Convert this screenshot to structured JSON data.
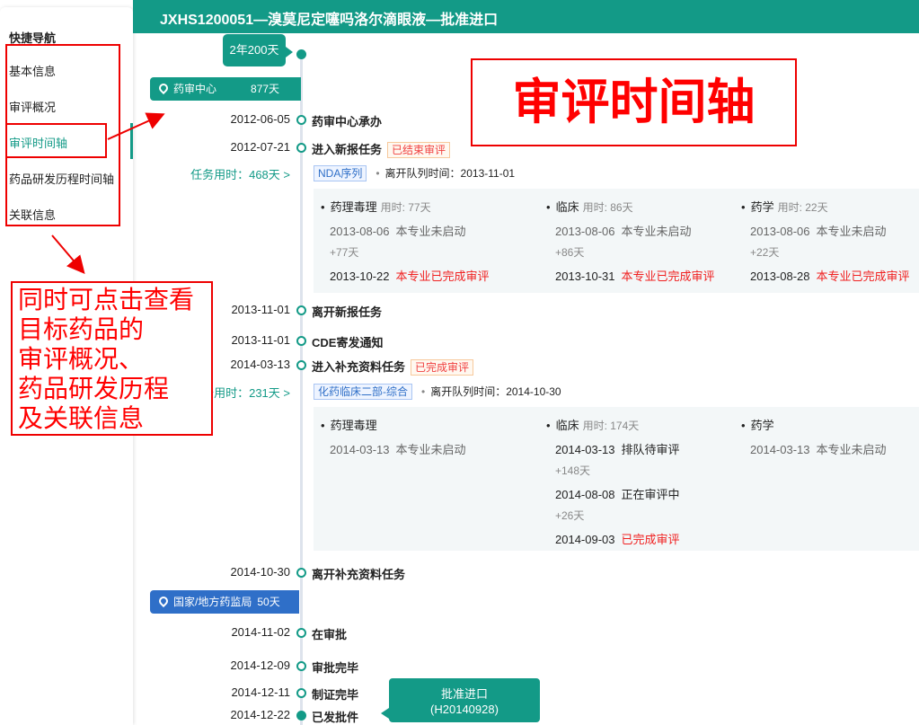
{
  "header": {
    "title": "JXHS1200051—溴莫尼定噻吗洛尔滴眼液—批准进口"
  },
  "sidebar": {
    "title": "快捷导航",
    "items": [
      {
        "label": "基本信息"
      },
      {
        "label": "审评概况"
      },
      {
        "label": "审评时间轴",
        "active": true
      },
      {
        "label": "药品研发历程时间轴"
      },
      {
        "label": "关联信息"
      }
    ]
  },
  "timeline": {
    "total": "2年200天",
    "stages": [
      {
        "name": "药审中心",
        "days": "877天",
        "color": "#139a87"
      },
      {
        "name": "国家/地方药监局",
        "days": "50天",
        "color": "#2f6fc8"
      }
    ],
    "events": [
      {
        "date": "2012-06-05",
        "label": "药审中心承办"
      },
      {
        "date": "2012-07-21",
        "label": "进入新报任务",
        "tag": "已结束审评"
      },
      {
        "date": "2013-11-01",
        "label": "离开新报任务"
      },
      {
        "date": "2013-11-01",
        "label": "CDE寄发通知"
      },
      {
        "date": "2014-03-13",
        "label": "进入补充资料任务",
        "tag": "已完成审评"
      },
      {
        "date": "2014-10-30",
        "label": "离开补充资料任务"
      },
      {
        "date": "2014-11-02",
        "label": "在审批"
      },
      {
        "date": "2014-12-09",
        "label": "审批完毕"
      },
      {
        "date": "2014-12-11",
        "label": "制证完毕"
      },
      {
        "date": "2014-12-22",
        "label": "已发批件"
      }
    ],
    "tasks": [
      {
        "duration": "任务用时：468天 >",
        "queue": "NDA序列",
        "leave": "离开队列时间：2013-11-01",
        "columns": [
          {
            "name": "药理毒理",
            "used": "用时: 77天",
            "rows": [
              {
                "date": "2013-08-06",
                "status": "本专业未启动"
              },
              {
                "delta": "+77天"
              },
              {
                "date": "2013-10-22",
                "status": "本专业已完成审评",
                "done": true
              }
            ]
          },
          {
            "name": "临床",
            "used": "用时: 86天",
            "rows": [
              {
                "date": "2013-08-06",
                "status": "本专业未启动"
              },
              {
                "delta": "+86天"
              },
              {
                "date": "2013-10-31",
                "status": "本专业已完成审评",
                "done": true
              }
            ]
          },
          {
            "name": "药学",
            "used": "用时: 22天",
            "rows": [
              {
                "date": "2013-08-06",
                "status": "本专业未启动"
              },
              {
                "delta": "+22天"
              },
              {
                "date": "2013-08-28",
                "status": "本专业已完成审评",
                "done": true
              }
            ]
          }
        ]
      },
      {
        "duration": "任务用时：231天 >",
        "queue": "化药临床二部-综合",
        "leave": "离开队列时间：2014-10-30",
        "columns": [
          {
            "name": "药理毒理",
            "used": "",
            "rows": [
              {
                "date": "2014-03-13",
                "status": "本专业未启动"
              }
            ]
          },
          {
            "name": "临床",
            "used": "用时: 174天",
            "rows": [
              {
                "date": "2014-03-13",
                "status": "排队待审评",
                "dark": true
              },
              {
                "delta": "+148天"
              },
              {
                "date": "2014-08-08",
                "status": "正在审评中",
                "dark": true
              },
              {
                "delta": "+26天"
              },
              {
                "date": "2014-09-03",
                "status": "已完成审评",
                "done": true
              }
            ]
          },
          {
            "name": "药学",
            "used": "",
            "rows": [
              {
                "date": "2014-03-13",
                "status": "本专业未启动"
              }
            ]
          }
        ]
      }
    ],
    "result": {
      "label": "批准进口",
      "code": "(H20140928)"
    }
  },
  "annotations": {
    "title": "审评时间轴",
    "note": "同时可点击查看目标药品的审评概况、药品研发历程及关联信息",
    "note_lines": [
      "同时可点击查看",
      "目标药品的",
      "审评概况、",
      "药品研发历程",
      "及关联信息"
    ]
  }
}
